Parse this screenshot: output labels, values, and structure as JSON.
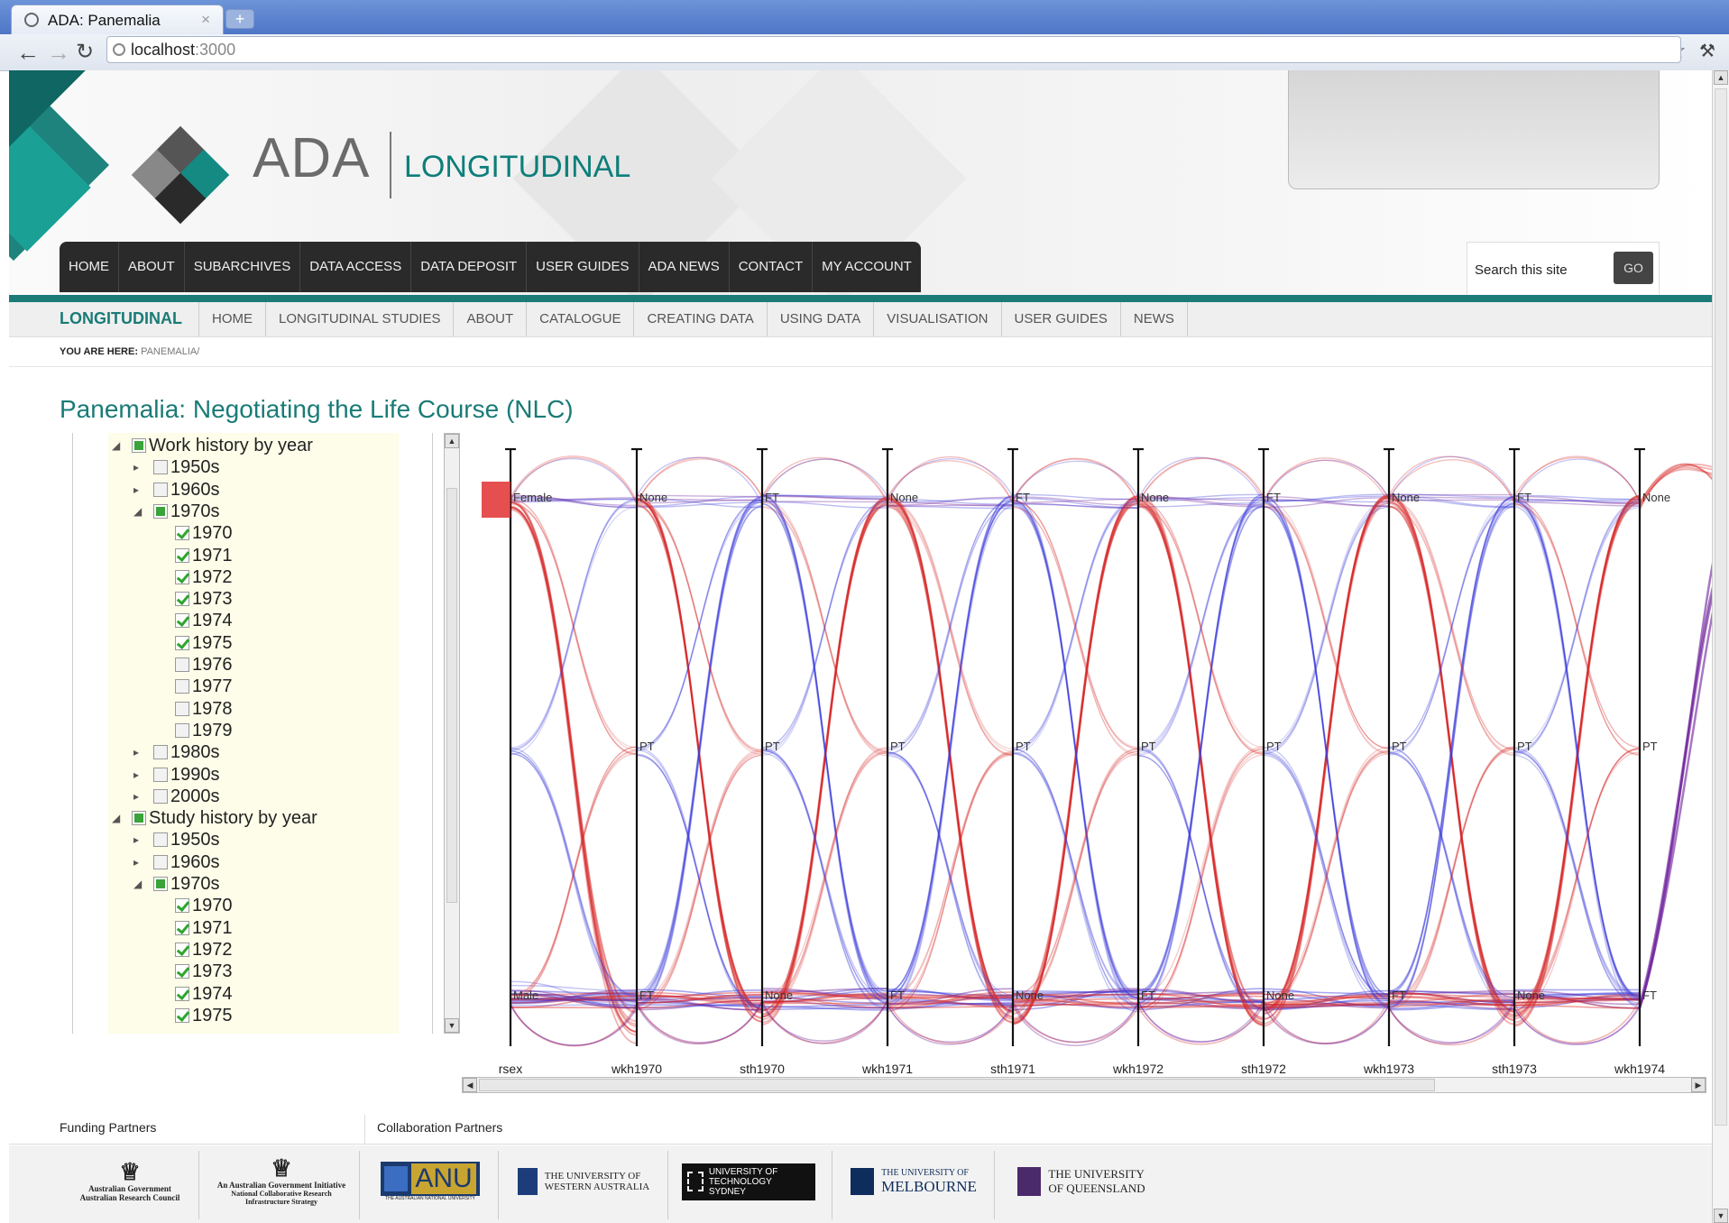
{
  "browser": {
    "tab_title": "ADA: Panemalia",
    "tab_close": "×",
    "new_tab": "+",
    "url_host": "localhost",
    "url_port": ":3000",
    "back_icon": "arrow-left-icon",
    "forward_icon": "arrow-right-icon",
    "reload_icon": "reload-icon",
    "star_icon": "star-icon",
    "wrench_icon": "wrench-icon"
  },
  "header": {
    "logo_ada": "ADA",
    "logo_longitudinal": "LONGITUDINAL",
    "nav": [
      "HOME",
      "ABOUT",
      "SUBARCHIVES",
      "DATA ACCESS",
      "DATA DEPOSIT",
      "USER GUIDES",
      "ADA NEWS",
      "CONTACT",
      "MY ACCOUNT"
    ],
    "search_placeholder": "Search this site",
    "search_button": "GO"
  },
  "subnav": {
    "brand": "LONGITUDINAL",
    "items": [
      "HOME",
      "LONGITUDINAL STUDIES",
      "ABOUT",
      "CATALOGUE",
      "CREATING DATA",
      "USING DATA",
      "VISUALISATION",
      "USER GUIDES",
      "NEWS"
    ]
  },
  "breadcrumb": {
    "label": "YOU ARE HERE:",
    "path": "PANEMALIA/"
  },
  "page_title": "Panemalia: Negotiating the Life Course (NLC)",
  "tree": [
    {
      "label": "Work history by year",
      "level": 0,
      "state": "part",
      "exp": "open"
    },
    {
      "label": "1950s",
      "level": 1,
      "state": "off",
      "exp": "closed"
    },
    {
      "label": "1960s",
      "level": 1,
      "state": "off",
      "exp": "closed"
    },
    {
      "label": "1970s",
      "level": 1,
      "state": "part",
      "exp": "open"
    },
    {
      "label": "1970",
      "level": 2,
      "state": "on"
    },
    {
      "label": "1971",
      "level": 2,
      "state": "on"
    },
    {
      "label": "1972",
      "level": 2,
      "state": "on"
    },
    {
      "label": "1973",
      "level": 2,
      "state": "on"
    },
    {
      "label": "1974",
      "level": 2,
      "state": "on"
    },
    {
      "label": "1975",
      "level": 2,
      "state": "on"
    },
    {
      "label": "1976",
      "level": 2,
      "state": "off"
    },
    {
      "label": "1977",
      "level": 2,
      "state": "off"
    },
    {
      "label": "1978",
      "level": 2,
      "state": "off"
    },
    {
      "label": "1979",
      "level": 2,
      "state": "off"
    },
    {
      "label": "1980s",
      "level": 1,
      "state": "off",
      "exp": "closed"
    },
    {
      "label": "1990s",
      "level": 1,
      "state": "off",
      "exp": "closed"
    },
    {
      "label": "2000s",
      "level": 1,
      "state": "off",
      "exp": "closed"
    },
    {
      "label": "Study history by year",
      "level": 0,
      "state": "part",
      "exp": "open"
    },
    {
      "label": "1950s",
      "level": 1,
      "state": "off",
      "exp": "closed"
    },
    {
      "label": "1960s",
      "level": 1,
      "state": "off",
      "exp": "closed"
    },
    {
      "label": "1970s",
      "level": 1,
      "state": "part",
      "exp": "open"
    },
    {
      "label": "1970",
      "level": 2,
      "state": "on"
    },
    {
      "label": "1971",
      "level": 2,
      "state": "on"
    },
    {
      "label": "1972",
      "level": 2,
      "state": "on"
    },
    {
      "label": "1973",
      "level": 2,
      "state": "on"
    },
    {
      "label": "1974",
      "level": 2,
      "state": "on"
    },
    {
      "label": "1975",
      "level": 2,
      "state": "on"
    }
  ],
  "chart_data": {
    "type": "parallel-sets",
    "axes": [
      "rsex",
      "wkh1970",
      "sth1970",
      "wkh1971",
      "sth1971",
      "wkh1972",
      "sth1972",
      "wkh1973",
      "sth1973",
      "wkh1974"
    ],
    "categories": {
      "rsex": [
        "Female",
        "",
        "Male"
      ],
      "wkh1970": [
        "None",
        "PT",
        "FT"
      ],
      "sth1970": [
        "FT",
        "PT",
        "None"
      ],
      "wkh1971": [
        "None",
        "PT",
        "FT"
      ],
      "sth1971": [
        "FT",
        "PT",
        "None"
      ],
      "wkh1972": [
        "None",
        "PT",
        "FT"
      ],
      "sth1972": [
        "FT",
        "PT",
        "None"
      ],
      "wkh1973": [
        "None",
        "PT",
        "FT"
      ],
      "sth1973": [
        "FT",
        "PT",
        "None"
      ],
      "wkh1974": [
        "None",
        "PT",
        "FT"
      ]
    },
    "colors": {
      "female": "#d62728",
      "male": "#3b3bdb",
      "mixed": "#6a1a9a",
      "selected": "#e03030"
    }
  },
  "footer": {
    "funding_label": "Funding Partners",
    "collab_label": "Collaboration Partners",
    "logos": [
      {
        "name": "Australian Government",
        "sub": "Australian Research Council"
      },
      {
        "name": "An Australian Government Initiative",
        "sub": "National Collaborative Research Infrastructure Strategy"
      },
      {
        "name": "ANU",
        "sub": "THE AUSTRALIAN NATIONAL UNIVERSITY"
      },
      {
        "name": "THE UNIVERSITY OF",
        "sub": "WESTERN AUSTRALIA"
      },
      {
        "name": "UNIVERSITY OF",
        "sub": "TECHNOLOGY SYDNEY"
      },
      {
        "name": "THE UNIVERSITY OF",
        "sub": "MELBOURNE"
      },
      {
        "name": "THE UNIVERSITY",
        "sub": "OF QUEENSLAND"
      }
    ]
  }
}
